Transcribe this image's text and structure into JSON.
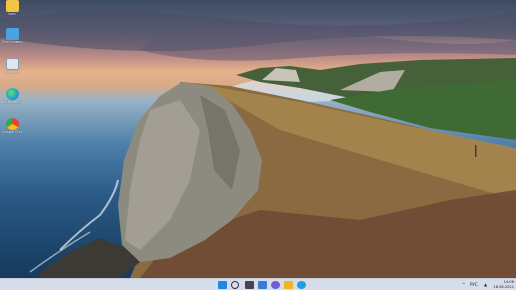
{
  "desktop": {
    "icons": [
      {
        "name": "folder-icon",
        "label": "Ivan",
        "color": "#f4c542"
      },
      {
        "name": "this-pc-icon",
        "label": "Этот компьютер",
        "color": "#4aa3df"
      },
      {
        "name": "recycle-bin-icon",
        "label": "Корзина",
        "color": "#dfe6ee"
      },
      {
        "name": "edge-icon",
        "label": "Microsoft Edge",
        "color": "#1fa0d8"
      },
      {
        "name": "chrome-icon",
        "label": "Google Chrome",
        "color": "#e94235"
      }
    ]
  },
  "taskbar": {
    "apps": [
      {
        "name": "start-button",
        "color": "#1e88e5"
      },
      {
        "name": "search-button",
        "color": "#334"
      },
      {
        "name": "task-view-button",
        "color": "#445"
      },
      {
        "name": "widgets-button",
        "color": "#3a7bd5"
      },
      {
        "name": "store-button",
        "color": "#2a6fb6"
      },
      {
        "name": "chat-button",
        "color": "#6b5fd3"
      },
      {
        "name": "file-explorer-button",
        "color": "#f0b429"
      },
      {
        "name": "edge-taskbar-button",
        "color": "#1fa0d8"
      }
    ],
    "tray": {
      "chevron": "^",
      "language": "РУС",
      "time": "14:06",
      "date": "18.08.2021"
    }
  }
}
